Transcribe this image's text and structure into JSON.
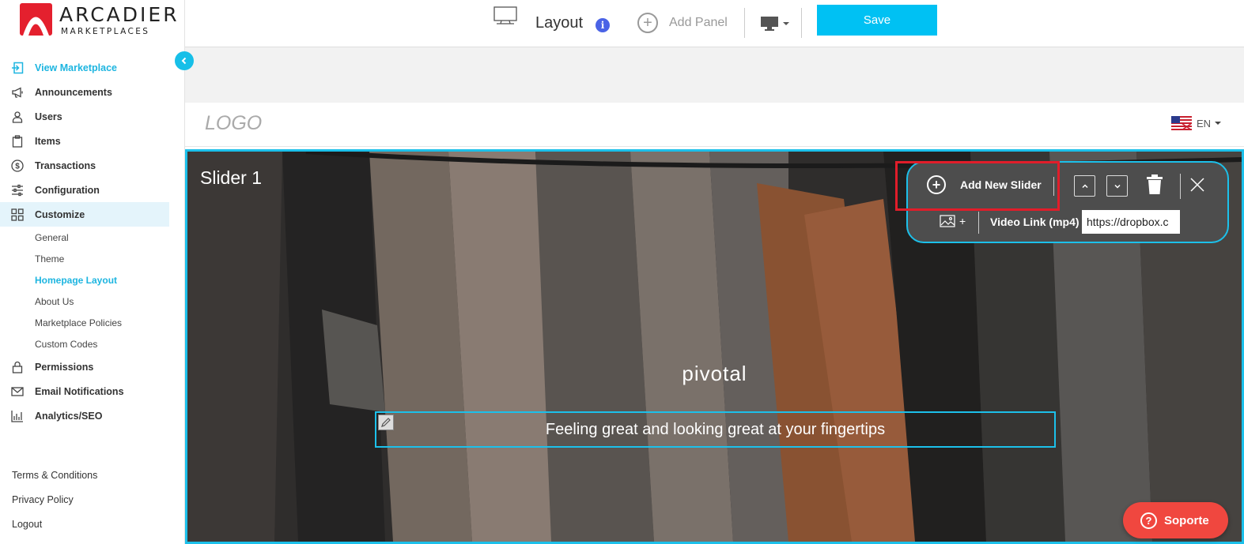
{
  "brand": {
    "name": "ARCADIER",
    "sub": "MARKETPLACES"
  },
  "sidebar": {
    "items": [
      {
        "label": "View Marketplace",
        "icon": "enter-icon"
      },
      {
        "label": "Announcements",
        "icon": "megaphone-icon"
      },
      {
        "label": "Users",
        "icon": "user-icon"
      },
      {
        "label": "Items",
        "icon": "clipboard-icon"
      },
      {
        "label": "Transactions",
        "icon": "dollar-icon"
      },
      {
        "label": "Configuration",
        "icon": "sliders-icon"
      },
      {
        "label": "Customize",
        "icon": "grid-icon"
      }
    ],
    "customize_sub": [
      "General",
      "Theme",
      "Homepage Layout",
      "About Us",
      "Marketplace Policies",
      "Custom Codes"
    ],
    "items_after": [
      {
        "label": "Permissions",
        "icon": "lock-icon"
      },
      {
        "label": "Email Notifications",
        "icon": "mail-icon"
      },
      {
        "label": "Analytics/SEO",
        "icon": "chart-icon"
      }
    ],
    "footer": [
      "Terms & Conditions",
      "Privacy Policy",
      "Logout"
    ]
  },
  "topbar": {
    "title": "Layout",
    "info": "i",
    "add_panel": "Add Panel",
    "save": "Save"
  },
  "site": {
    "logo": "LOGO",
    "lang": "EN"
  },
  "slider": {
    "title": "Slider 1",
    "heading": "pivotal",
    "caption": "Feeling great and looking great at your fingertips"
  },
  "toolbar": {
    "add_new_slider": "Add New Slider",
    "image_plus": "+",
    "video_label": "Video Link (mp4)",
    "video_value": "https://dropbox.c"
  },
  "support": {
    "label": "Soporte"
  },
  "colors": {
    "accent": "#1cc0ea",
    "save": "#00c1f3",
    "highlight": "#e11d2a",
    "support": "#f0473f"
  }
}
